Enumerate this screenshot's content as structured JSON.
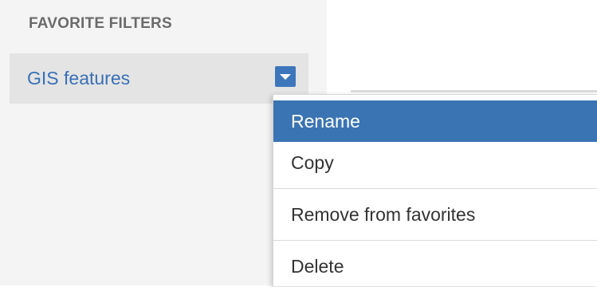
{
  "sidebar": {
    "section_title": "FAVORITE FILTERS",
    "items": [
      {
        "label": "GIS features"
      }
    ]
  },
  "context_menu": {
    "items": [
      {
        "label": "Rename",
        "highlighted": true
      },
      {
        "label": "Copy"
      },
      {
        "label": "Remove from favorites"
      },
      {
        "label": "Delete"
      }
    ]
  },
  "colors": {
    "accent": "#3a74b3",
    "link": "#3870b5",
    "sidebar_bg": "#f4f4f4"
  },
  "icons": {
    "dropdown": "caret-down-icon"
  }
}
